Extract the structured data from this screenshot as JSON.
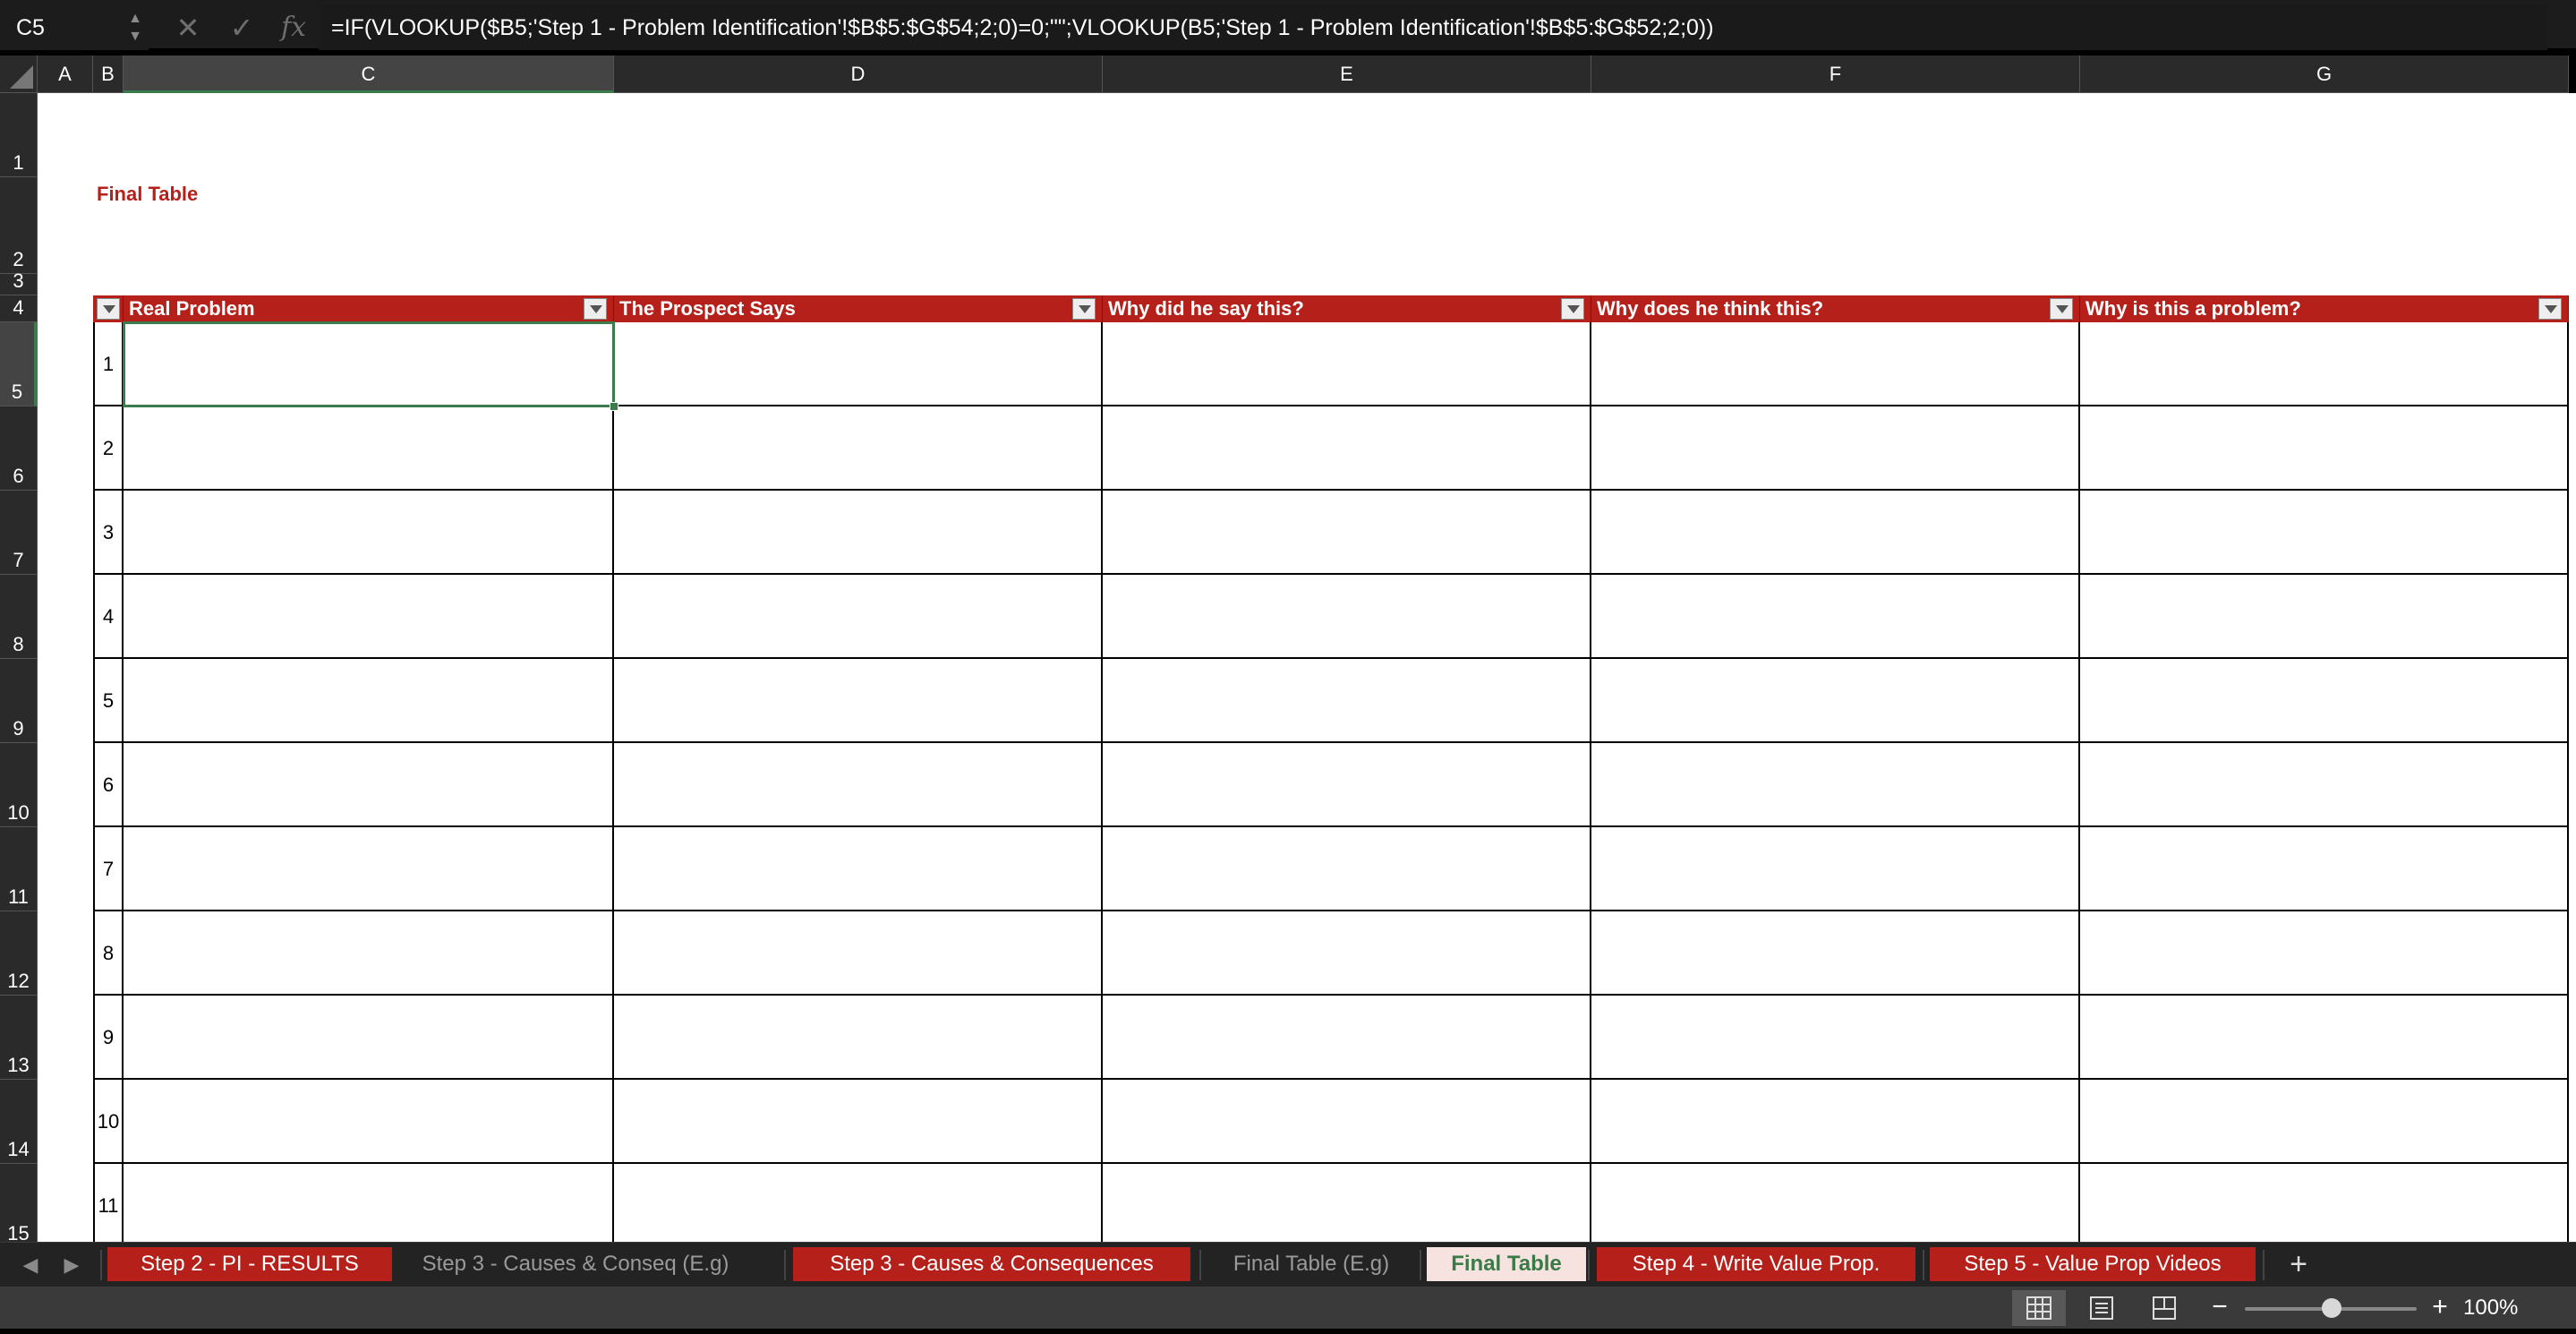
{
  "formula_bar": {
    "name_box": "C5",
    "cancel_icon": "✕",
    "enter_icon": "✓",
    "fx_label": "fx",
    "formula": "=IF(VLOOKUP($B5;'Step 1 - Problem Identification'!$B$5:$G$54;2;0)=0;\"\";VLOOKUP(B5;'Step 1 - Problem Identification'!$B$5:$G$52;2;0))"
  },
  "grid": {
    "columns": [
      "A",
      "B",
      "C",
      "D",
      "E",
      "F",
      "G"
    ],
    "rows": [
      "1",
      "2",
      "3",
      "4",
      "5",
      "6",
      "7",
      "8",
      "9",
      "10",
      "11",
      "12",
      "13",
      "14",
      "15"
    ],
    "selected_column": "C",
    "selected_row": "5"
  },
  "sheet": {
    "title": "Final Table",
    "table_headers": [
      "Real Problem",
      "The Prospect Says",
      "Why did he say this?",
      "Why does he think this?",
      "Why is this a problem?"
    ],
    "row_numbers": [
      "1",
      "2",
      "3",
      "4",
      "5",
      "6",
      "7",
      "8",
      "9",
      "10",
      "11"
    ],
    "accent_color": "#b5201a"
  },
  "tabs": [
    {
      "label": "Step 2 - PI - RESULTS",
      "style": "red"
    },
    {
      "label": "Step 3 - Causes & Conseq (E.g)",
      "style": "plain"
    },
    {
      "label": "Step 3 - Causes & Consequences",
      "style": "red"
    },
    {
      "label": "Final Table (E.g)",
      "style": "plain"
    },
    {
      "label": "Final Table",
      "style": "active"
    },
    {
      "label": "Step 4 - Write Value Prop.",
      "style": "red"
    },
    {
      "label": "Step 5 - Value Prop Videos",
      "style": "red"
    }
  ],
  "tab_nav": {
    "prev_icon": "◀",
    "next_icon": "▶",
    "add_icon": "+"
  },
  "status": {
    "zoom": "100%",
    "zoom_minus": "−",
    "zoom_plus": "+"
  }
}
